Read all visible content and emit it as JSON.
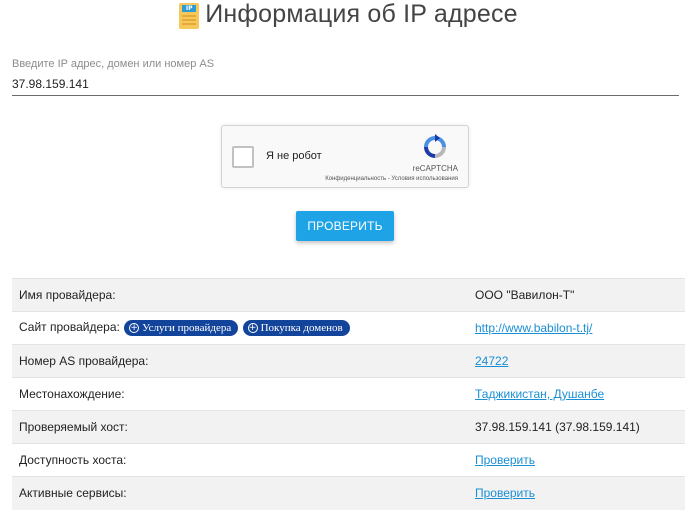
{
  "header": {
    "icon_tag": "IP",
    "title": "Информация об IP адресе"
  },
  "search": {
    "label": "Введите IP адрес, домен или номер AS",
    "value": "37.98.159.141"
  },
  "captcha": {
    "label": "Я не робот",
    "brand": "reCAPTCHA",
    "links": "Конфиденциальность - Условия использования"
  },
  "check_button": {
    "label": "ПРОВЕРИТЬ"
  },
  "info": {
    "rows": [
      {
        "key": "Имя провайдера:",
        "value": "ООО \"Вавилон-Т\""
      },
      {
        "key": "Сайт провайдера:",
        "value": "http://www.babilon-t.tj/"
      },
      {
        "key": "Номер AS провайдера:",
        "value": "24722"
      },
      {
        "key": "Местонахождение:",
        "value": "Таджикистан, Душанбе"
      },
      {
        "key": "Проверяемый хост:",
        "value": "37.98.159.141 (37.98.159.141)"
      },
      {
        "key": "Доступность хоста:",
        "value": "Проверить"
      },
      {
        "key": "Активные сервисы:",
        "value": "Проверить"
      }
    ],
    "pills": {
      "services": "Услуги провайдера",
      "domains": "Покупка доменов"
    }
  },
  "colors": {
    "accent": "#1da3e6",
    "pill": "#13449c",
    "link": "#1a8fd4"
  }
}
